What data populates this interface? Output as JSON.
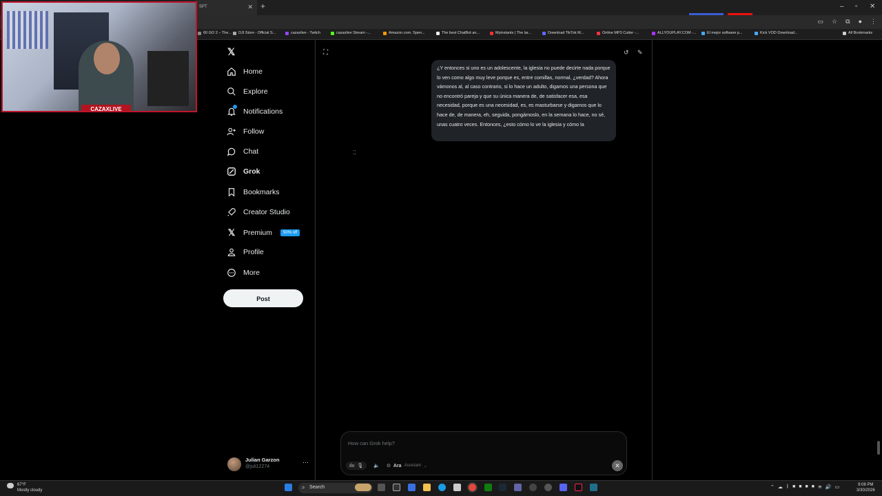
{
  "browser": {
    "tab_title": "SPT",
    "bookmarks": [
      {
        "label": "60 GO 2 – The...",
        "color": "#888"
      },
      {
        "label": "DJI Store - Official S...",
        "color": "#aaa"
      },
      {
        "label": "cazaxlive - Twitch",
        "color": "#9146ff"
      },
      {
        "label": "cazaxlive Stream -...",
        "color": "#53fc18"
      },
      {
        "label": "Amazon.com. Spen...",
        "color": "#f90"
      },
      {
        "label": "The best ChatBot an...",
        "color": "#eee"
      },
      {
        "label": "Myinstants | The lar...",
        "color": "#e33"
      },
      {
        "label": "Download TikTok M...",
        "color": "#66f"
      },
      {
        "label": "Online MP3 Cutter -...",
        "color": "#e34"
      },
      {
        "label": "ALLYOUPLAY.COM -...",
        "color": "#a3f"
      },
      {
        "label": "El mejor software p...",
        "color": "#4af"
      },
      {
        "label": "Kick VOD Download...",
        "color": "#4af"
      }
    ],
    "all_bookmarks": "All Bookmarks"
  },
  "webcam": {
    "label": "CAZAXLIVE"
  },
  "nav": {
    "home": "Home",
    "explore": "Explore",
    "notifications": "Notifications",
    "follow": "Follow",
    "chat": "Chat",
    "grok": "Grok",
    "bookmarks": "Bookmarks",
    "creator_studio": "Creator Studio",
    "premium": "Premium",
    "premium_badge": "50% off",
    "profile": "Profile",
    "more": "More",
    "post": "Post"
  },
  "account": {
    "name": "Julian Garzon",
    "handle": "@juli12274"
  },
  "chat": {
    "message": "¿Y entonces si uno es un adolescente, la iglesia no puede decirte nada porque lo ven como algo muy leve porque es, entre comillas, normal, ¿verdad? Ahora vámonos al, al caso contrario, si lo hace un adulto, digamos una persona que no encontró pareja y que su única manera de, de satisfacer esa, esa necesidad, porque es una necesidad, es, es masturbarse y digamos que lo hace de, de manera, eh, seguida, pongámoslo, en la semana lo hace, no sé, unas cuatro veces. Entonces, ¿esto cómo lo ve la iglesia y cómo la"
  },
  "composer": {
    "placeholder": "How can Grok help?",
    "voice_name": "Ara",
    "voice_role": "Assistant"
  },
  "taskbar": {
    "weather_temp": "67°F",
    "weather_desc": "Mostly cloudy",
    "search": "Search",
    "time": "9:08 PM",
    "date": "3/30/2026"
  }
}
